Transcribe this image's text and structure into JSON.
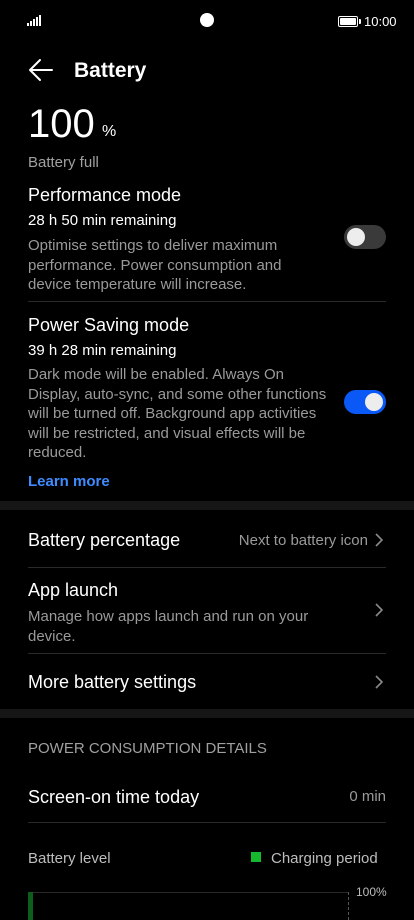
{
  "status_bar": {
    "time": "10:00"
  },
  "header": {
    "title": "Battery"
  },
  "battery": {
    "percent": "100",
    "unit": "%",
    "status": "Battery full"
  },
  "performance_mode": {
    "title": "Performance mode",
    "remaining": "28 h 50 min remaining",
    "description": "Optimise settings to deliver maximum performance. Power consumption and device temperature will increase.",
    "enabled": false
  },
  "power_saving_mode": {
    "title": "Power Saving mode",
    "remaining": "39 h 28 min remaining",
    "description": "Dark mode will be enabled. Always On Display, auto-sync, and some other functions will be turned off. Background app activities will be restricted, and visual effects will be reduced.",
    "enabled": true,
    "learn_more": "Learn more"
  },
  "settings": {
    "battery_percentage": {
      "label": "Battery percentage",
      "value": "Next to battery icon"
    },
    "app_launch": {
      "label": "App launch",
      "description": "Manage how apps launch and run on your device."
    },
    "more_settings": {
      "label": "More battery settings"
    }
  },
  "power_consumption": {
    "heading": "POWER CONSUMPTION DETAILS",
    "screen_on_label": "Screen-on time today",
    "screen_on_value": "0 min",
    "battery_level_label": "Battery level",
    "legend_label": "Charging period",
    "axis_max_label": "100%"
  },
  "colors": {
    "accent": "#0a59f7",
    "link": "#3f8cff",
    "charging": "#16b82e"
  }
}
